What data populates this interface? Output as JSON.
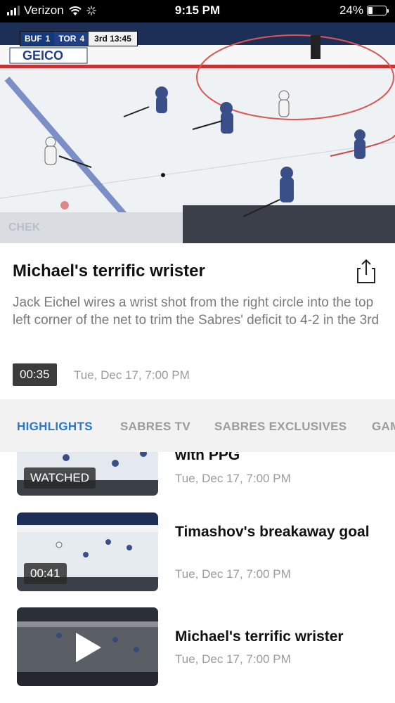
{
  "status_bar": {
    "carrier": "Verizon",
    "time": "9:15 PM",
    "battery": "24%",
    "battery_level": 0.24
  },
  "video": {
    "scoreboard": {
      "team_a": "BUF",
      "score_a": "1",
      "team_b": "TOR",
      "score_b": "4",
      "period": "3rd",
      "clock": "13:45"
    },
    "title": "Michael's terrific wrister",
    "description": "Jack Eichel wires a wrist shot from the right circle into the top left corner of the net to trim the Sabres' deficit to 4-2 in the 3rd",
    "duration": "00:35",
    "date": "Tue, Dec 17, 7:00 PM",
    "share_icon": "share-icon"
  },
  "tabs": [
    {
      "label": "HIGHLIGHTS",
      "active": true
    },
    {
      "label": "SABRES TV",
      "active": false
    },
    {
      "label": "SABRES EXCLUSIVES",
      "active": false
    },
    {
      "label": "GAME",
      "active": false
    }
  ],
  "list": [
    {
      "title": "with PPG",
      "date": "Tue, Dec 17, 7:00 PM",
      "badge": "WATCHED"
    },
    {
      "title": "Timashov's breakaway goal",
      "date": "Tue, Dec 17, 7:00 PM",
      "badge": "00:41"
    },
    {
      "title": "Michael's terrific wrister",
      "date": "Tue, Dec 17, 7:00 PM",
      "badge": "",
      "icon": "play-icon"
    }
  ],
  "colors": {
    "accent": "#2d77c9",
    "badge": "#3c3c3c"
  }
}
